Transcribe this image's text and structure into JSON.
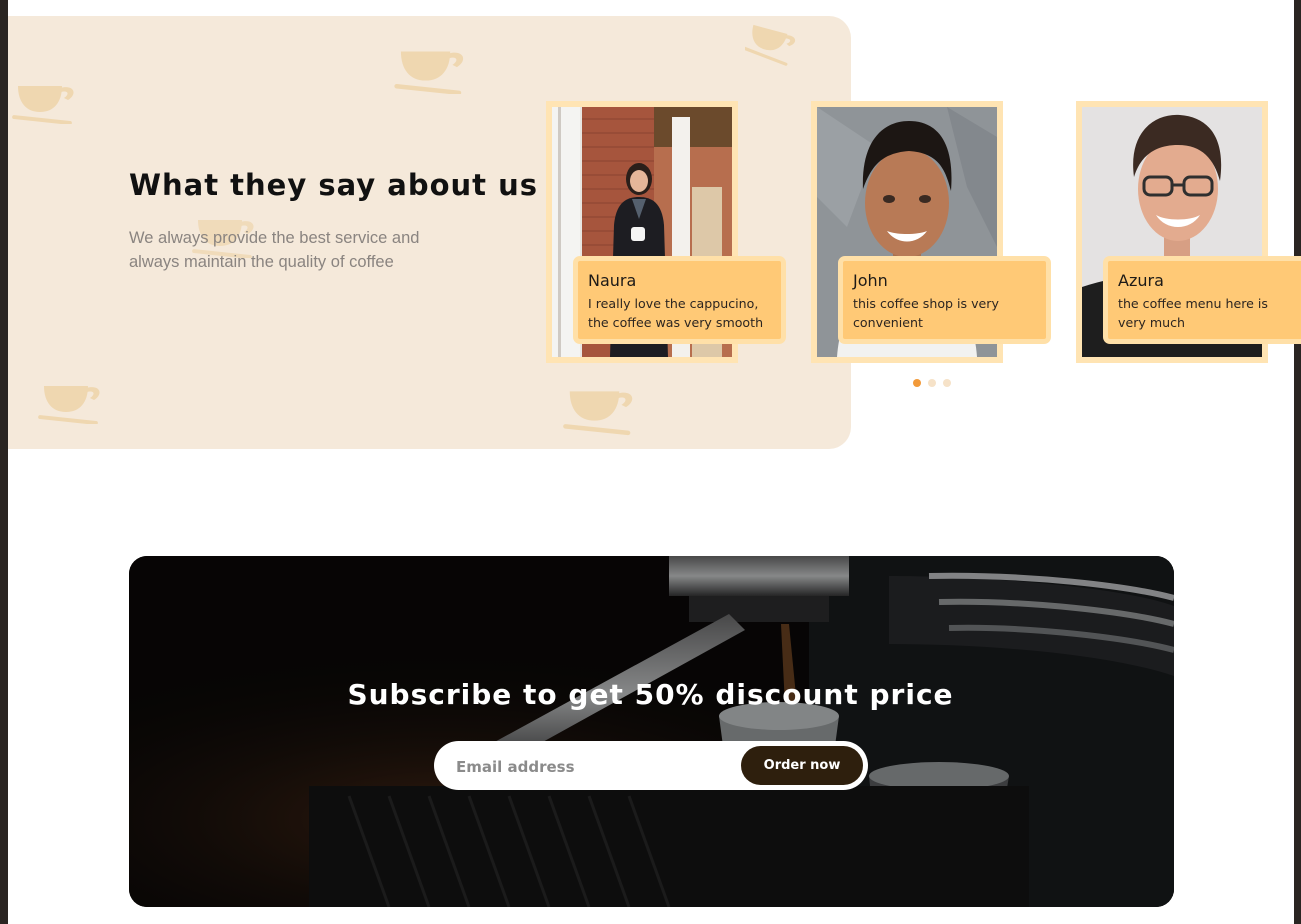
{
  "testimonials_section": {
    "title": "What they say about us",
    "subtitle": "We always provide the best service and always maintain the quality of coffee",
    "decoration_icon": "coffee-cup-icon",
    "colors": {
      "panel_bg": "#f5e9da",
      "card_frame": "#ffe4b3",
      "quote_bg": "#ffc976",
      "dot_active": "#f29a3a"
    },
    "cards": [
      {
        "name": "Naura",
        "text": "I really love the cappucino, the coffee was very smooth"
      },
      {
        "name": "John",
        "text": "this coffee shop is very convenient"
      },
      {
        "name": "Azura",
        "text": "the coffee menu here is very much"
      }
    ],
    "pagination": {
      "count": 3,
      "active": 0
    }
  },
  "subscribe_section": {
    "title": "Subscribe to get 50% discount price",
    "email_placeholder": "Email address",
    "email_value": "",
    "button_label": "Order now",
    "colors": {
      "button_bg": "#2e1f0d"
    }
  }
}
